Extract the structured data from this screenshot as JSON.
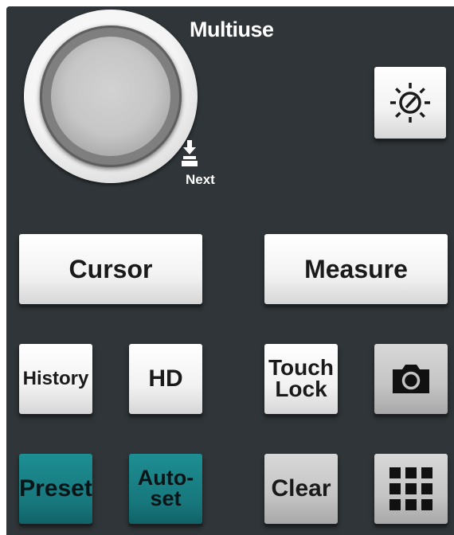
{
  "title": "Multiuse",
  "knob": {
    "next_label": "Next"
  },
  "buttons": {
    "cursor": "Cursor",
    "measure": "Measure",
    "history": "History",
    "hd": "HD",
    "touch_lock": "Touch\nLock",
    "preset": "Preset",
    "autoset": "Auto-\nset",
    "clear": "Clear"
  },
  "colors": {
    "panel": "#2f3538",
    "teal": "#17777c",
    "white_button": "#f2f2f2",
    "gray_button": "#c4c4c4"
  },
  "icons": {
    "intensity": "intensity-knob-icon",
    "screenshot": "camera-icon",
    "apps": "grid-menu-icon",
    "next": "push-arrow-icon"
  }
}
